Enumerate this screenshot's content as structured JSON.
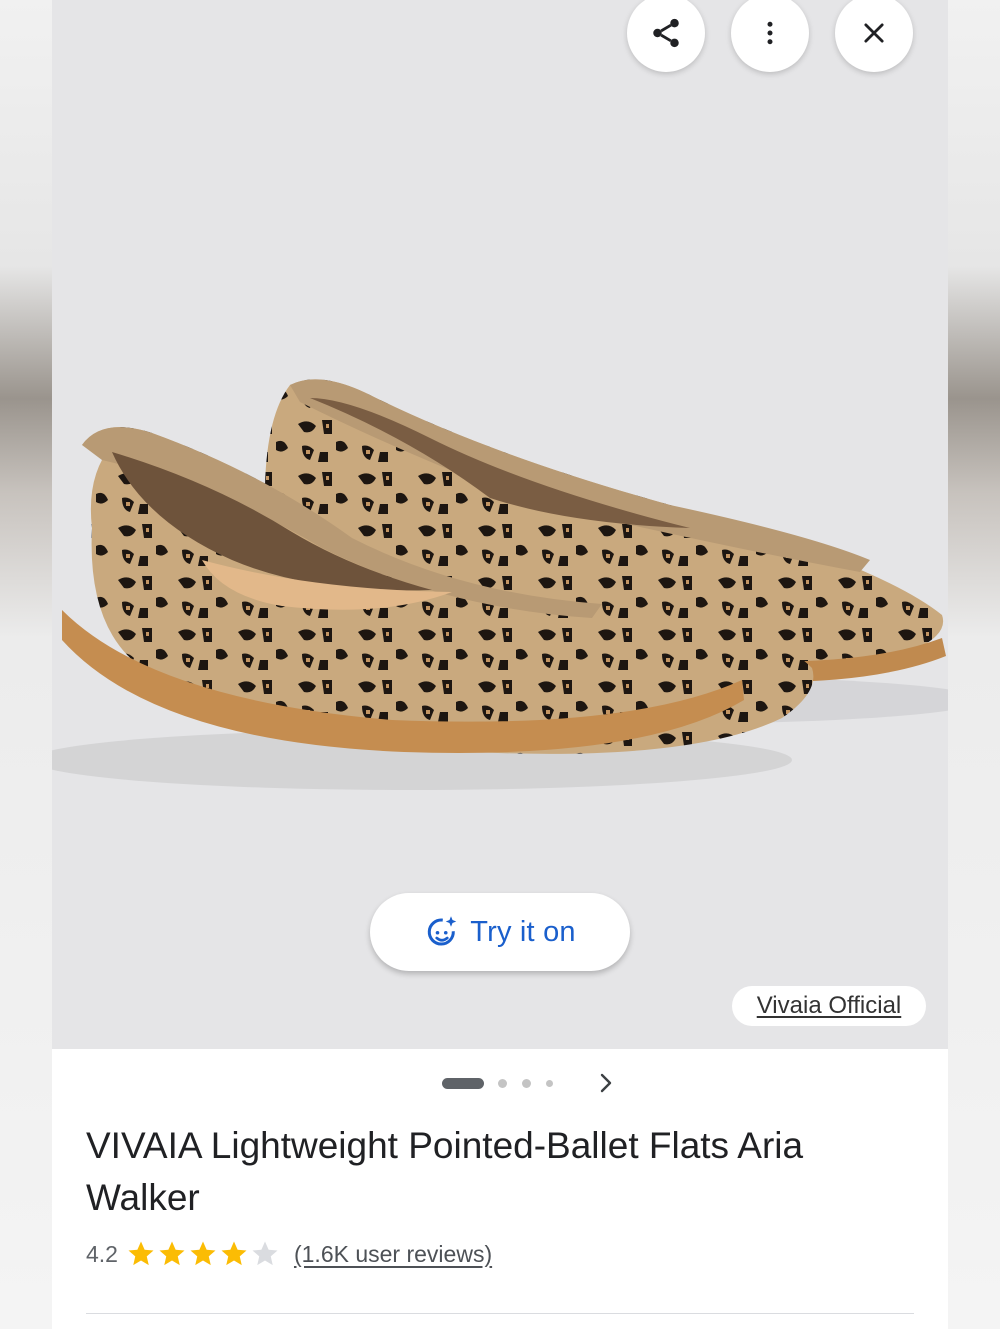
{
  "header_actions": {
    "share_icon": "share-icon",
    "more_icon": "more-vertical-icon",
    "close_icon": "close-icon"
  },
  "media": {
    "image_description_icon": "product-image",
    "try_on_label": "Try it on",
    "try_on_icon": "face-sparkle-icon",
    "source_label": "Vivaia Official",
    "carousel": {
      "total": 5,
      "current": 1
    }
  },
  "product": {
    "title": "VIVAIA Lightweight Pointed-Ballet Flats Aria Walker",
    "rating_value": "4.2",
    "rating_stars": 4.2,
    "reviews_label": "(1.6K user reviews)"
  },
  "colors": {
    "accent_blue": "#1a5fcc",
    "star_gold": "#fbbc04",
    "star_empty": "#dadce0"
  }
}
